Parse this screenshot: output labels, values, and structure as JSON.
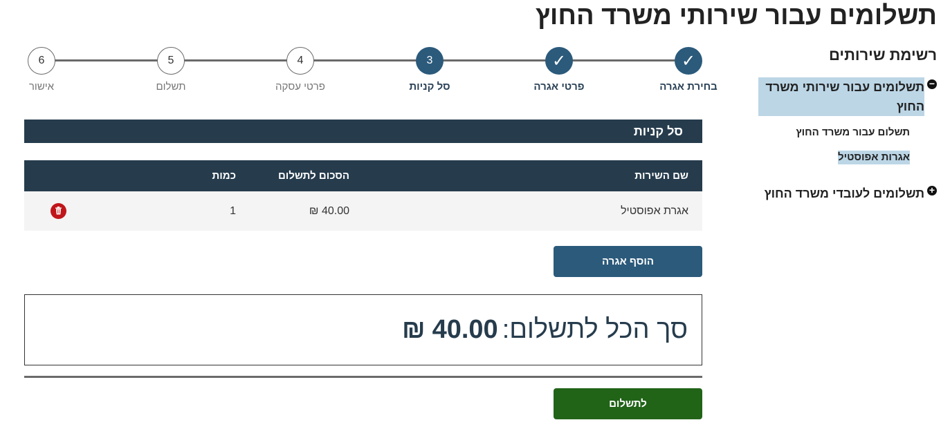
{
  "page": {
    "title": "תשלומים עבור שירותי משרד החוץ"
  },
  "sidebar": {
    "title": "רשימת שירותים",
    "groups": [
      {
        "label": "תשלומים עבור שירותי משרד החוץ",
        "toggle_icon": "minus-circle-icon",
        "expanded": true,
        "items": [
          {
            "label": "תשלום עבור משרד החוץ"
          },
          {
            "label": "אגרות אפוסטיל",
            "selected": true
          }
        ]
      },
      {
        "label": "תשלומים לעובדי משרד החוץ",
        "toggle_icon": "plus-circle-icon",
        "expanded": false
      }
    ]
  },
  "stepper": {
    "steps": [
      {
        "number": "1",
        "label": "בחירת אגרה",
        "state": "done"
      },
      {
        "number": "2",
        "label": "פרטי אגרה",
        "state": "done"
      },
      {
        "number": "3",
        "label": "סל קניות",
        "state": "current"
      },
      {
        "number": "4",
        "label": "פרטי עסקה",
        "state": "todo"
      },
      {
        "number": "5",
        "label": "תשלום",
        "state": "todo"
      },
      {
        "number": "6",
        "label": "אישור",
        "state": "todo"
      }
    ],
    "done_icon": "✓"
  },
  "cart": {
    "header": "סל קניות",
    "columns": {
      "name": "שם השירות",
      "amount": "הסכום לתשלום",
      "qty": "כמות"
    },
    "rows": [
      {
        "name": "אגרת אפוסטיל",
        "amount": "40.00 ₪",
        "qty": "1"
      }
    ],
    "delete_icon": "trash-icon"
  },
  "actions": {
    "add_fee": "הוסף אגרה",
    "pay": "לתשלום"
  },
  "total": {
    "label": "סך הכל לתשלום:",
    "amount": "40.00",
    "currency": "₪"
  },
  "colors": {
    "primary": "#2b5a7b",
    "header_dark": "#263c4d",
    "pay_green": "#216418",
    "delete_red": "#c0161b",
    "selected_bg": "#bcd6e6"
  }
}
